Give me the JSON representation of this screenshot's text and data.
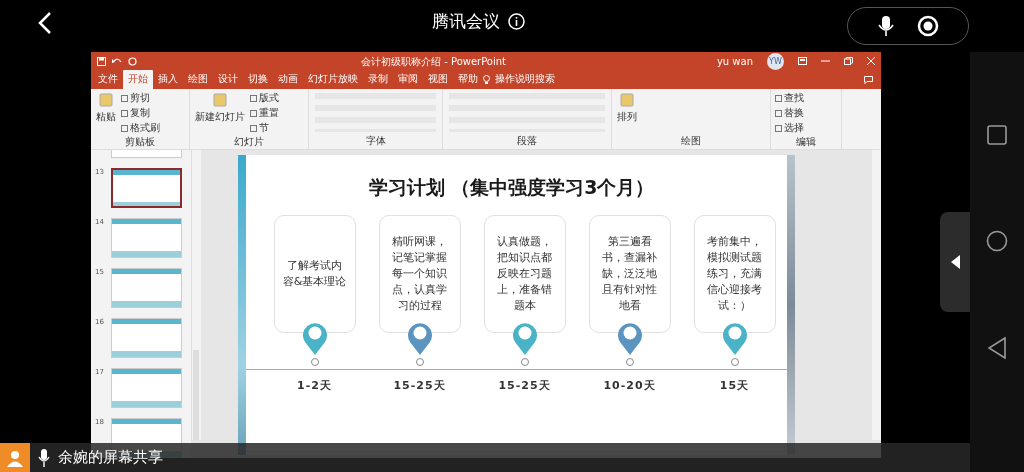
{
  "meeting_bar": {
    "title": "腾讯会议"
  },
  "powerpoint": {
    "title": "会计初级职称介绍 - PowerPoint",
    "user": "yu wan",
    "avatar": "YW",
    "tabs": [
      {
        "label": "文件",
        "selected": false
      },
      {
        "label": "开始",
        "selected": true
      },
      {
        "label": "插入",
        "selected": false
      },
      {
        "label": "绘图",
        "selected": false
      },
      {
        "label": "设计",
        "selected": false
      },
      {
        "label": "切换",
        "selected": false
      },
      {
        "label": "动画",
        "selected": false
      },
      {
        "label": "幻灯片放映",
        "selected": false
      },
      {
        "label": "录制",
        "selected": false
      },
      {
        "label": "审阅",
        "selected": false
      },
      {
        "label": "视图",
        "selected": false
      },
      {
        "label": "帮助",
        "selected": false
      }
    ],
    "tell_me": "操作说明搜索",
    "ribbon_groups": [
      {
        "name": "剪贴板",
        "big": "粘贴",
        "small": [
          "剪切",
          "复制",
          "格式刷"
        ]
      },
      {
        "name": "幻灯片",
        "big": "新建幻灯片",
        "small": [
          "版式",
          "重置",
          "节"
        ]
      },
      {
        "name": "字体"
      },
      {
        "name": "段落"
      },
      {
        "name": "绘图",
        "big": "排列"
      },
      {
        "name": "编辑",
        "small": [
          "查找",
          "替换",
          "选择"
        ]
      }
    ],
    "thumbnails": [
      {
        "number": "13",
        "selected": true
      },
      {
        "number": "14",
        "selected": false
      },
      {
        "number": "15",
        "selected": false
      },
      {
        "number": "16",
        "selected": false
      },
      {
        "number": "17",
        "selected": false
      },
      {
        "number": "18",
        "selected": false
      }
    ],
    "slide": {
      "title": "学习计划 （集中强度学习3个月）",
      "steps": [
        {
          "text": "了解考试内容&基本理论",
          "days": "1-2天",
          "color": "#4bb3c8"
        },
        {
          "text": "精听网课，记笔记掌握每一个知识点，认真学习的过程",
          "days": "15-25天",
          "color": "#5b95bf"
        },
        {
          "text": "认真做题，把知识点都反映在习题上，准备错题本",
          "days": "15-25天",
          "color": "#4bb3c8"
        },
        {
          "text": "第三遍看书，查漏补缺，泛泛地且有针对性地看",
          "days": "10-20天",
          "color": "#5b95bf"
        },
        {
          "text": "考前集中，模拟测试题练习，充满信心迎接考试：）",
          "days": "15天",
          "color": "#4bb3c8"
        }
      ]
    }
  },
  "share_banner": {
    "label": "余婉的屏幕共享"
  }
}
